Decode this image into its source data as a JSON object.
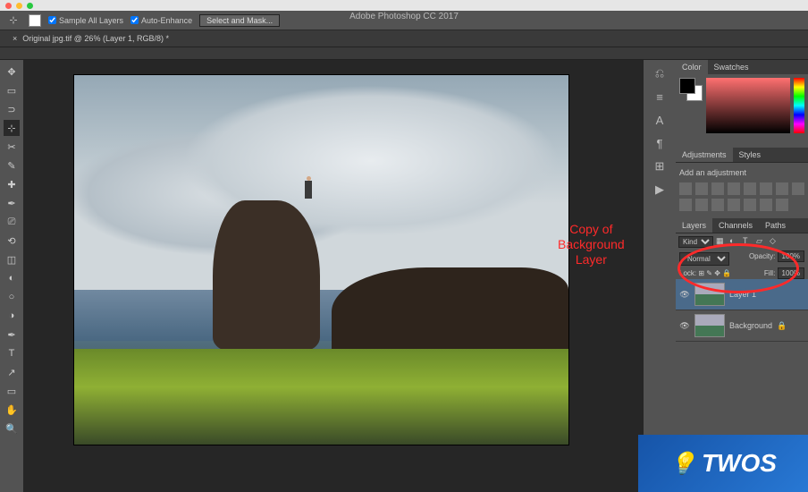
{
  "app": {
    "title": "Adobe Photoshop CC 2017"
  },
  "options_bar": {
    "sample_all": "Sample All Layers",
    "auto_enhance": "Auto-Enhance",
    "select_mask": "Select and Mask..."
  },
  "document": {
    "tab_label": "Original jpg.tif @ 26% (Layer 1, RGB/8) *"
  },
  "panels": {
    "color_tab": "Color",
    "swatches_tab": "Swatches",
    "adjustments_tab": "Adjustments",
    "styles_tab": "Styles",
    "add_adjustment": "Add an adjustment",
    "layers_tab": "Layers",
    "channels_tab": "Channels",
    "paths_tab": "Paths"
  },
  "layers": {
    "kind_label": "Kind",
    "blend_mode": "Normal",
    "opacity_label": "Opacity:",
    "opacity_value": "100%",
    "lock_label": "Lock:",
    "fill_label": "Fill:",
    "fill_value": "100%",
    "items": [
      {
        "name": "Layer 1",
        "active": true,
        "locked": false
      },
      {
        "name": "Background",
        "active": false,
        "locked": true
      }
    ]
  },
  "annotation": {
    "line1": "Copy of",
    "line2": "Background",
    "line3": "Layer"
  },
  "brand": {
    "name": "TWOS",
    "emoji": "💡"
  },
  "tools": [
    "↖",
    "▭",
    "⊹",
    "✎",
    "⮑",
    "↗",
    "✒",
    "⊞",
    "⎚",
    "◐",
    "T",
    "▲",
    "✋",
    "🔍"
  ],
  "right_icons": [
    "⎌",
    "≡",
    "A",
    "¶",
    "⊞",
    "▶"
  ]
}
